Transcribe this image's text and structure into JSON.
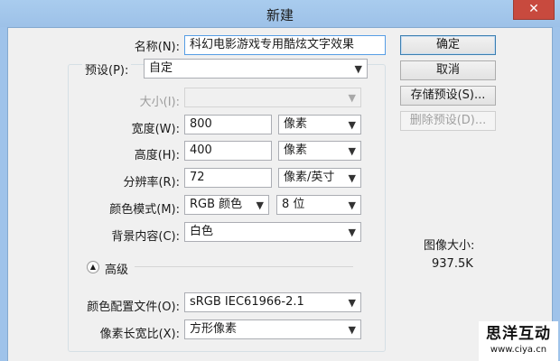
{
  "window": {
    "title": "新建",
    "close_glyph": "✕"
  },
  "fields": {
    "name": {
      "label": "名称(N):",
      "value": "科幻电影游戏专用酷炫文字效果"
    },
    "preset": {
      "label": "预设(P):",
      "value": "自定"
    },
    "size": {
      "label": "大小(I):",
      "value": ""
    },
    "width": {
      "label": "宽度(W):",
      "value": "800",
      "unit": "像素"
    },
    "height": {
      "label": "高度(H):",
      "value": "400",
      "unit": "像素"
    },
    "resolution": {
      "label": "分辨率(R):",
      "value": "72",
      "unit": "像素/英寸"
    },
    "color_mode": {
      "label": "颜色模式(M):",
      "value": "RGB 颜色",
      "depth": "8 位"
    },
    "background": {
      "label": "背景内容(C):",
      "value": "白色"
    },
    "advanced_label": "高级",
    "color_profile": {
      "label": "颜色配置文件(O):",
      "value": "sRGB IEC61966-2.1"
    },
    "pixel_aspect": {
      "label": "像素长宽比(X):",
      "value": "方形像素"
    }
  },
  "buttons": {
    "ok": "确定",
    "cancel": "取消",
    "save_preset": "存储预设(S)...",
    "delete_preset": "删除预设(D)..."
  },
  "image_size": {
    "label": "图像大小:",
    "value": "937.5K"
  },
  "watermark": {
    "title": "思洋互动",
    "url": "www.ciya.cn"
  },
  "icons": {
    "dropdown": "chevron-down-icon",
    "expand": "chevron-up-icon",
    "close": "close-icon"
  }
}
